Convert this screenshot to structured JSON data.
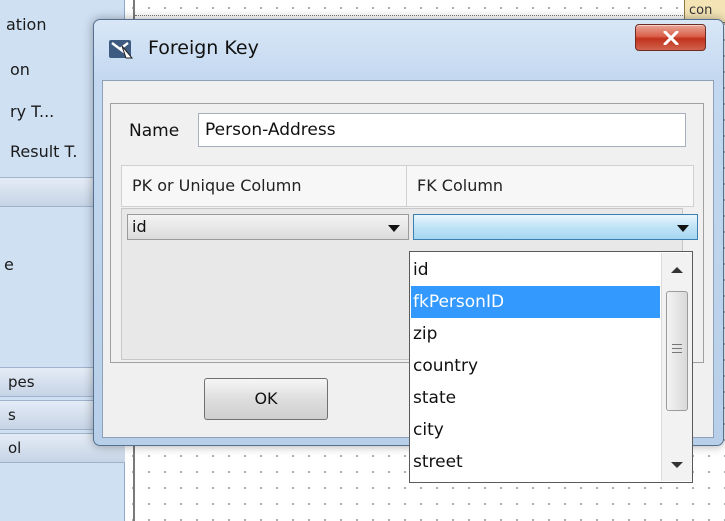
{
  "background": {
    "left_panel": {
      "items": [
        "ation",
        "on",
        "ry T...",
        "Result T."
      ],
      "middle_item": "e",
      "sections": [
        "pes",
        "s",
        "ol"
      ]
    },
    "canvas_box_label": "con"
  },
  "dialog": {
    "title": "Foreign Key",
    "name_label": "Name",
    "name_value": "Person-Address",
    "columns": {
      "pk_header": "PK or Unique Column",
      "fk_header": "FK Column"
    },
    "row": {
      "pk_value": "id",
      "fk_value": ""
    },
    "ok_label": "OK"
  },
  "dropdown": {
    "options": [
      "id",
      "fkPersonID",
      "zip",
      "country",
      "state",
      "city",
      "street"
    ],
    "selected_index": 1
  },
  "colors": {
    "selection": "#3399ff",
    "close_button": "#c2321c",
    "combo_focus": "#3c7fb1"
  }
}
